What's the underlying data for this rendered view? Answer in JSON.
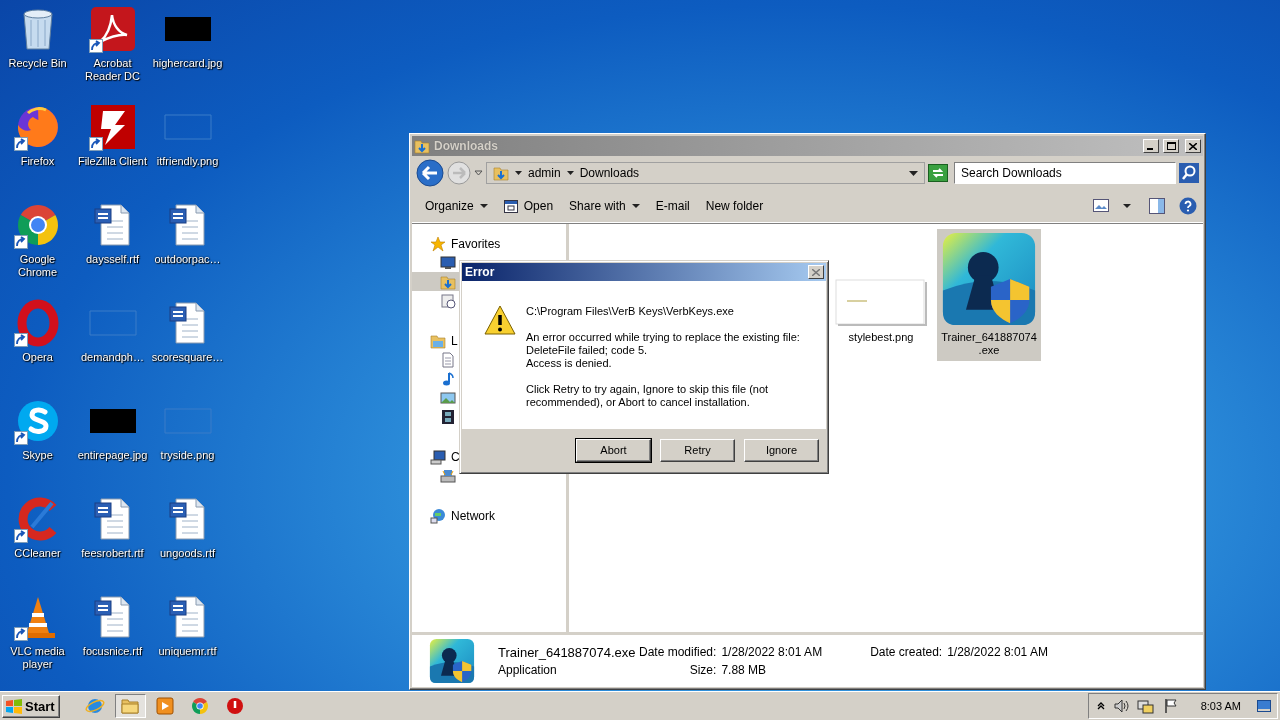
{
  "desktop": {
    "icons": [
      {
        "label": "Recycle Bin",
        "kind": "recycle",
        "shortcut": false
      },
      {
        "label": "Acrobat Reader DC",
        "kind": "pdf",
        "shortcut": true
      },
      {
        "label": "highercard.jpg",
        "kind": "image-dark",
        "shortcut": false
      },
      {
        "label": "Firefox",
        "kind": "firefox",
        "shortcut": true
      },
      {
        "label": "FileZilla Client",
        "kind": "filezilla",
        "shortcut": true
      },
      {
        "label": "itfriendly.png",
        "kind": "image-blank",
        "shortcut": false
      },
      {
        "label": "Google Chrome",
        "kind": "chrome",
        "shortcut": true
      },
      {
        "label": "daysself.rtf",
        "kind": "word",
        "shortcut": false
      },
      {
        "label": "outdoorpac…",
        "kind": "word",
        "shortcut": false
      },
      {
        "label": "Opera",
        "kind": "opera",
        "shortcut": true
      },
      {
        "label": "demandph…",
        "kind": "image-blank",
        "shortcut": false
      },
      {
        "label": "scoresquare…",
        "kind": "word",
        "shortcut": false
      },
      {
        "label": "Skype",
        "kind": "skype",
        "shortcut": true
      },
      {
        "label": "entirepage.jpg",
        "kind": "image-dark",
        "shortcut": false
      },
      {
        "label": "tryside.png",
        "kind": "image-blank",
        "shortcut": false
      },
      {
        "label": "CCleaner",
        "kind": "ccleaner",
        "shortcut": true
      },
      {
        "label": "feesrobert.rtf",
        "kind": "word",
        "shortcut": false
      },
      {
        "label": "ungoods.rtf",
        "kind": "word",
        "shortcut": false
      },
      {
        "label": "VLC media player",
        "kind": "vlc",
        "shortcut": true
      },
      {
        "label": "focusnice.rtf",
        "kind": "word",
        "shortcut": false
      },
      {
        "label": "uniquemr.rtf",
        "kind": "word",
        "shortcut": false
      }
    ]
  },
  "explorer": {
    "title": "Downloads",
    "breadcrumb": [
      "admin",
      "Downloads"
    ],
    "search": {
      "placeholder": "Search Downloads"
    },
    "toolbar": [
      {
        "label": "Organize",
        "kind": "menu"
      },
      {
        "label": "Open",
        "kind": "open"
      },
      {
        "label": "Share with",
        "kind": "menu"
      },
      {
        "label": "E-mail",
        "kind": "plain"
      },
      {
        "label": "New folder",
        "kind": "plain"
      }
    ],
    "nav": [
      {
        "label": "Favorites",
        "kind": "star",
        "selected": false,
        "children": [
          {
            "kind": "desktop",
            "selected": false
          },
          {
            "kind": "downloads",
            "selected": true
          },
          {
            "kind": "recent",
            "selected": false
          }
        ]
      },
      {
        "label": "L",
        "kind": "library",
        "selected": false,
        "children": [
          {
            "kind": "document",
            "selected": false
          },
          {
            "kind": "music",
            "selected": false
          },
          {
            "kind": "pictures",
            "selected": false
          },
          {
            "kind": "videos",
            "selected": false
          }
        ]
      },
      {
        "label": "C",
        "kind": "computer",
        "selected": false,
        "children": [
          {
            "kind": "disk",
            "selected": false
          }
        ]
      },
      {
        "label": "Network",
        "kind": "network",
        "selected": false
      }
    ],
    "files": [
      {
        "name": "stylebest.png",
        "kind": "image",
        "selected": false
      },
      {
        "name": "Trainer_641887074.exe",
        "kind": "app",
        "selected": true
      }
    ],
    "details": {
      "name": "Trainer_641887074.exe",
      "type": "Application",
      "fields": [
        {
          "label": "Date modified:",
          "value": "1/28/2022 8:01 AM"
        },
        {
          "label": "Date created:",
          "value": "1/28/2022 8:01 AM"
        },
        {
          "label": "Size:",
          "value": "7.88 MB"
        }
      ]
    }
  },
  "dialog": {
    "title": "Error",
    "path": "C:\\Program Files\\VerB Keys\\VerbKeys.exe",
    "message": [
      "An error occurred while trying to replace the existing file:",
      "DeleteFile failed; code 5.",
      "Access is denied."
    ],
    "hint": "Click Retry to try again, Ignore to skip this file (not recommended), or Abort to cancel installation.",
    "buttons": [
      {
        "label": "Abort",
        "focused": true
      },
      {
        "label": "Retry",
        "focused": false
      },
      {
        "label": "Ignore",
        "focused": false
      }
    ]
  },
  "taskbar": {
    "start": "Start",
    "pinned": [
      {
        "kind": "ie",
        "active": false
      },
      {
        "kind": "explorer",
        "active": true
      },
      {
        "kind": "media",
        "active": false
      },
      {
        "kind": "chrome",
        "active": false
      },
      {
        "kind": "stop",
        "active": false
      }
    ],
    "clock": "8:03 AM"
  }
}
